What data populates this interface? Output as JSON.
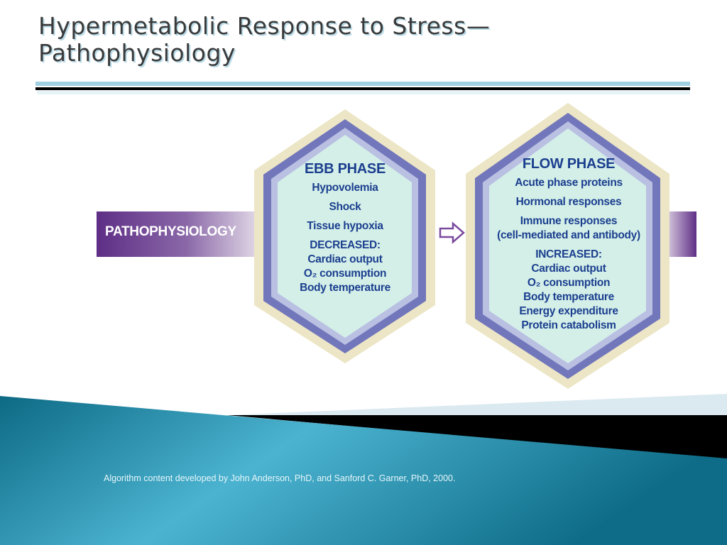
{
  "title": {
    "line1": "Hypermetabolic Response to Stress—",
    "line2": "Pathophysiology"
  },
  "diagram": {
    "banner_label": "PATHOPHYSIOLOGY",
    "arrow_icon": "hollow-right-arrow",
    "ebb": {
      "heading": "EBB PHASE",
      "items": [
        "Hypovolemia",
        "Shock",
        "Tissue hypoxia"
      ],
      "change_label": "DECREASED:",
      "changes": [
        "Cardiac output",
        "O₂ consumption",
        "Body temperature"
      ]
    },
    "flow": {
      "heading": "FLOW PHASE",
      "items": [
        "Acute phase proteins",
        "Hormonal responses",
        "Immune responses\n(cell-mediated and antibody)"
      ],
      "change_label": "INCREASED:",
      "changes": [
        "Cardiac output",
        "O₂ consumption",
        "Body temperature",
        "Energy expenditure",
        "Protein catabolism"
      ]
    },
    "colors": {
      "text": "#1b3f8f",
      "fill": "#d4efe8",
      "border": "#7c7fc0",
      "frame": "#ede7c8",
      "banner": "#6a3a8e"
    }
  },
  "footer": {
    "credit": "Algorithm content developed by John Anderson, PhD, and Sanford C. Garner, PhD, 2000."
  }
}
